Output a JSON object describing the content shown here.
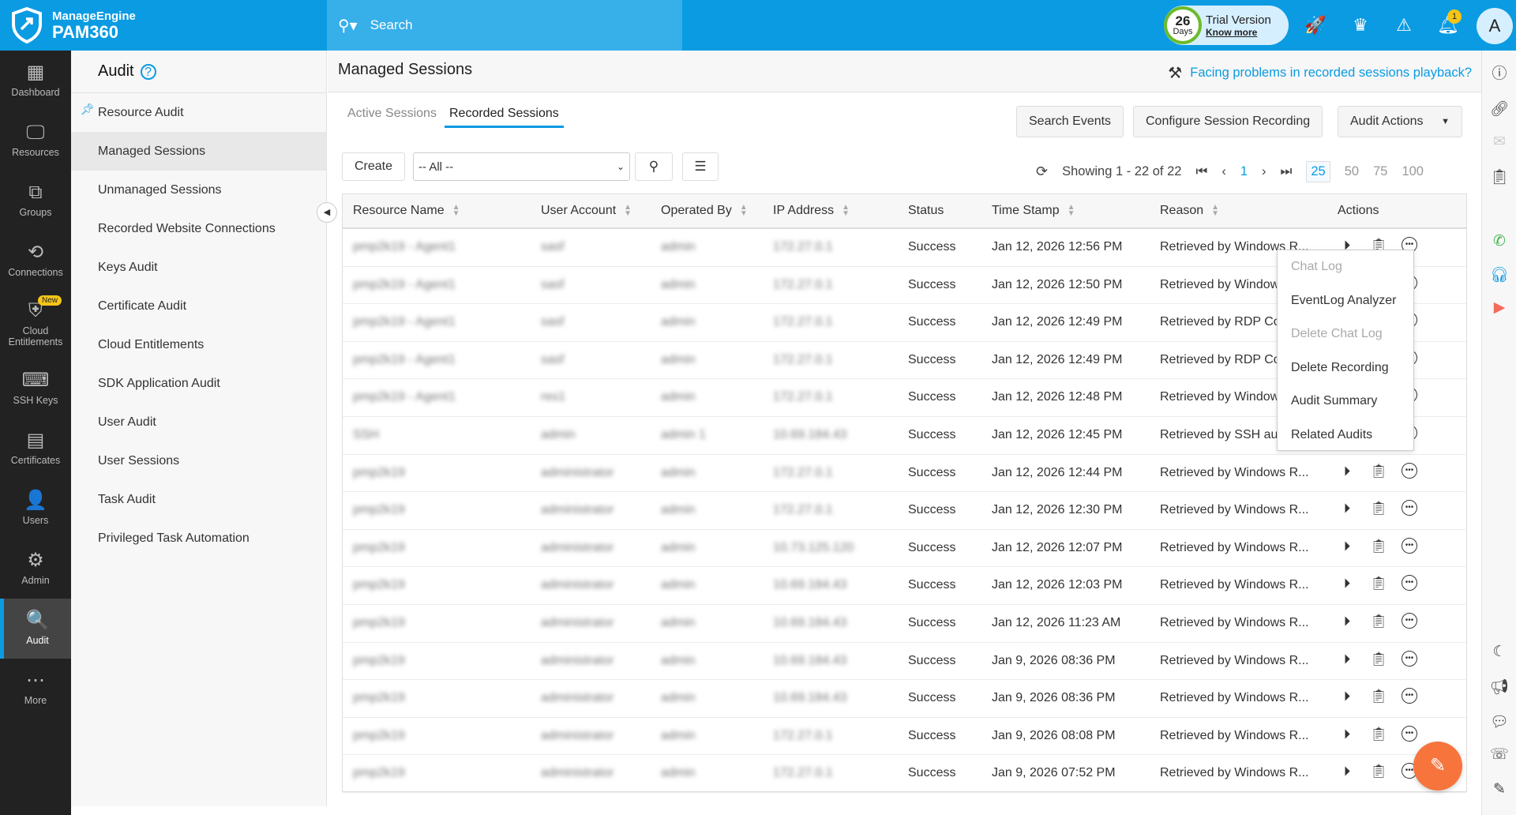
{
  "brand": {
    "line1": "ManageEngine",
    "line2": "PAM360"
  },
  "search": {
    "placeholder": "Search"
  },
  "trial": {
    "days": "26",
    "days_label": "Days",
    "title": "Trial Version",
    "link": "Know more"
  },
  "notifications": {
    "count": "1"
  },
  "avatar": "A",
  "nav": [
    {
      "label": "Dashboard",
      "icon": "▦"
    },
    {
      "label": "Resources",
      "icon": "🖵"
    },
    {
      "label": "Groups",
      "icon": "⧉"
    },
    {
      "label": "Connections",
      "icon": "⟲"
    },
    {
      "label": "Cloud Entitlements",
      "icon": "⛨",
      "badge": "New"
    },
    {
      "label": "SSH Keys",
      "icon": "⌨"
    },
    {
      "label": "Certificates",
      "icon": "▤"
    },
    {
      "label": "Users",
      "icon": "👤"
    },
    {
      "label": "Admin",
      "icon": "⚙"
    },
    {
      "label": "Audit",
      "icon": "🔍",
      "active": true
    },
    {
      "label": "More",
      "icon": "⋯"
    }
  ],
  "sub": {
    "title": "Audit",
    "items": [
      "Resource Audit",
      "Managed Sessions",
      "Unmanaged Sessions",
      "Recorded Website Connections",
      "Keys Audit",
      "Certificate Audit",
      "Cloud Entitlements",
      "SDK Application Audit",
      "User Audit",
      "User Sessions",
      "Task Audit",
      "Privileged Task Automation"
    ],
    "active": "Managed Sessions"
  },
  "page": {
    "title": "Managed Sessions",
    "help_link": "Facing problems in recorded sessions playback?"
  },
  "tabs": [
    "Active Sessions",
    "Recorded Sessions"
  ],
  "active_tab": "Recorded Sessions",
  "toolbar": {
    "search_events": "Search Events",
    "configure": "Configure Session Recording",
    "audit_actions": "Audit Actions",
    "create": "Create",
    "filter": "-- All --"
  },
  "pager": {
    "showing": "Showing 1 - 22 of 22",
    "page": "1",
    "sizes": [
      "25",
      "50",
      "75",
      "100"
    ],
    "selected_size": "25"
  },
  "columns": [
    "Resource Name",
    "User Account",
    "Operated By",
    "IP Address",
    "Status",
    "Time Stamp",
    "Reason",
    "Actions"
  ],
  "rows": [
    [
      "pmp2k19 - Agent1",
      "sasf",
      "admin",
      "172.27.0.1",
      "Success",
      "Jan 12, 2026 12:56 PM",
      "Retrieved by Windows R..."
    ],
    [
      "pmp2k19 - Agent1",
      "sasf",
      "admin",
      "172.27.0.1",
      "Success",
      "Jan 12, 2026 12:50 PM",
      "Retrieved by Windows R..."
    ],
    [
      "pmp2k19 - Agent1",
      "sasf",
      "admin",
      "172.27.0.1",
      "Success",
      "Jan 12, 2026 12:49 PM",
      "Retrieved by RDP Co..."
    ],
    [
      "pmp2k19 - Agent1",
      "sasf",
      "admin",
      "172.27.0.1",
      "Success",
      "Jan 12, 2026 12:49 PM",
      "Retrieved by RDP Co..."
    ],
    [
      "pmp2k19 - Agent1",
      "res1",
      "admin",
      "172.27.0.1",
      "Success",
      "Jan 12, 2026 12:48 PM",
      "Retrieved by Windows R..."
    ],
    [
      "SSH",
      "admin",
      "admin 1",
      "10.69.184.43",
      "Success",
      "Jan 12, 2026 12:45 PM",
      "Retrieved by SSH au..."
    ],
    [
      "pmp2k19",
      "administrator",
      "admin",
      "172.27.0.1",
      "Success",
      "Jan 12, 2026 12:44 PM",
      "Retrieved by Windows R..."
    ],
    [
      "pmp2k19",
      "administrator",
      "admin",
      "172.27.0.1",
      "Success",
      "Jan 12, 2026 12:30 PM",
      "Retrieved by Windows R..."
    ],
    [
      "pmp2k19",
      "administrator",
      "admin",
      "10.73.125.120",
      "Success",
      "Jan 12, 2026 12:07 PM",
      "Retrieved by Windows R..."
    ],
    [
      "pmp2k19",
      "administrator",
      "admin",
      "10.69.184.43",
      "Success",
      "Jan 12, 2026 12:03 PM",
      "Retrieved by Windows R..."
    ],
    [
      "pmp2k19",
      "administrator",
      "admin",
      "10.69.184.43",
      "Success",
      "Jan 12, 2026 11:23 AM",
      "Retrieved by Windows R..."
    ],
    [
      "pmp2k19",
      "administrator",
      "admin",
      "10.69.184.43",
      "Success",
      "Jan 9, 2026 08:36 PM",
      "Retrieved by Windows R..."
    ],
    [
      "pmp2k19",
      "administrator",
      "admin",
      "10.69.184.43",
      "Success",
      "Jan 9, 2026 08:36 PM",
      "Retrieved by Windows R..."
    ],
    [
      "pmp2k19",
      "administrator",
      "admin",
      "172.27.0.1",
      "Success",
      "Jan 9, 2026 08:08 PM",
      "Retrieved by Windows R..."
    ],
    [
      "pmp2k19",
      "administrator",
      "admin",
      "172.27.0.1",
      "Success",
      "Jan 9, 2026 07:52 PM",
      "Retrieved by Windows R..."
    ]
  ],
  "context_menu": [
    {
      "label": "Chat Log",
      "disabled": true
    },
    {
      "label": "EventLog Analyzer"
    },
    {
      "label": "Delete Chat Log",
      "disabled": true
    },
    {
      "label": "Delete Recording"
    },
    {
      "label": "Audit Summary"
    },
    {
      "label": "Related Audits"
    }
  ],
  "colors": {
    "brand": "#0a9be2",
    "nav_bg": "#222222",
    "fab": "#f7753d"
  }
}
